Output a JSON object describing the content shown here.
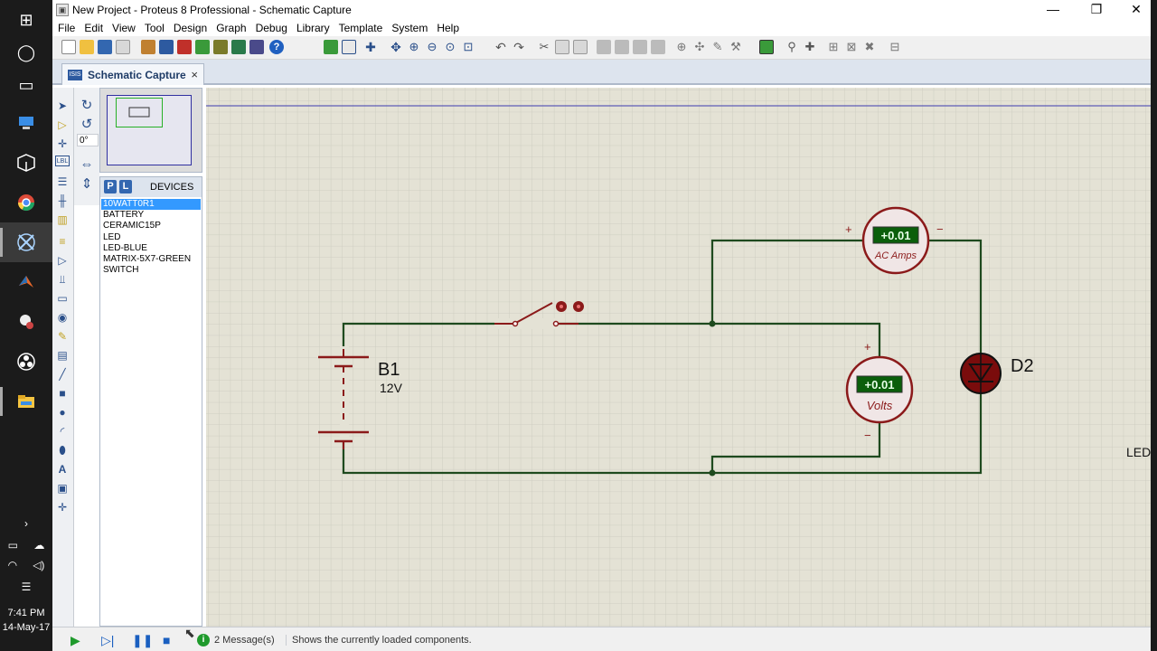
{
  "taskbar": {
    "icons": [
      "windows-logo-icon",
      "cortana-circle-icon",
      "task-view-icon",
      "monitor-app-icon",
      "box-app-icon",
      "chrome-icon",
      "proteus-icon",
      "matlab-icon",
      "mascot-app-icon",
      "obs-icon",
      "file-explorer-icon"
    ],
    "clock_time": "7:41 PM",
    "clock_date": "14-May-17"
  },
  "window": {
    "title": "New Project - Proteus 8 Professional - Schematic Capture",
    "controls": {
      "minimize": "—",
      "restore": "❐",
      "close": "✕"
    }
  },
  "menu": {
    "items": [
      "File",
      "Edit",
      "View",
      "Tool",
      "Design",
      "Graph",
      "Debug",
      "Library",
      "Template",
      "System",
      "Help"
    ]
  },
  "tab": {
    "label": "Schematic Capture",
    "close": "×",
    "icon_text": "ISIS"
  },
  "rotation": {
    "angle": "0°"
  },
  "devices": {
    "p_label": "P",
    "l_label": "L",
    "header": "DEVICES",
    "items": [
      "10WATT0R1",
      "BATTERY",
      "CERAMIC15P",
      "LED",
      "LED-BLUE",
      "MATRIX-5X7-GREEN",
      "SWITCH"
    ],
    "selected_index": 0
  },
  "schematic": {
    "battery_ref": "B1",
    "battery_value": "12V",
    "ammeter_reading": "+0.01",
    "ammeter_unit": "AC Amps",
    "voltmeter_reading": "+0.01",
    "voltmeter_unit": "Volts",
    "plus": "+",
    "minus": "−",
    "diode_ref": "D2",
    "edge_label": "LED",
    "wire_color": "#1e4a1e",
    "component_color": "#8b1a1a"
  },
  "status": {
    "messages": "2 Message(s)",
    "hint": "Shows the currently loaded components.",
    "info_icon": "i"
  }
}
